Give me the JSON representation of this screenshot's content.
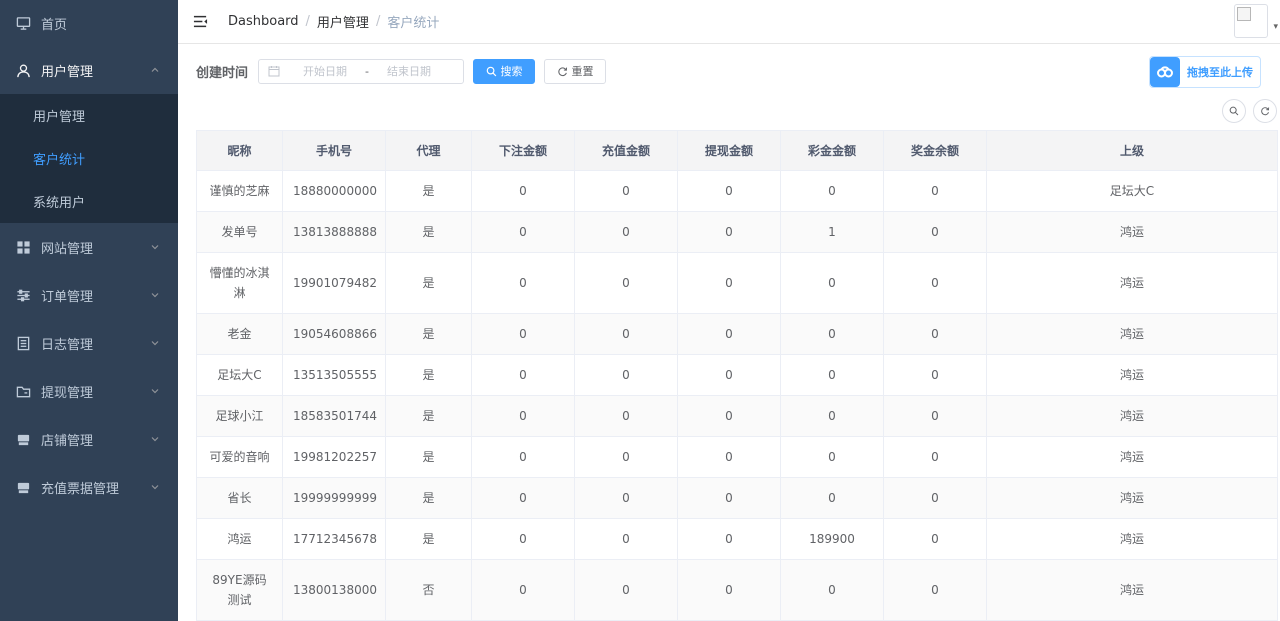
{
  "sidebar": {
    "home": "首页",
    "user_mgmt": "用户管理",
    "sub": [
      "用户管理",
      "客户统计",
      "系统用户"
    ],
    "groups": [
      "网站管理",
      "订单管理",
      "日志管理",
      "提现管理",
      "店铺管理",
      "充值票据管理"
    ]
  },
  "header": {
    "breadcrumb": [
      "Dashboard",
      "用户管理",
      "客户统计"
    ],
    "separator": "/"
  },
  "filter": {
    "label": "创建时间",
    "start_placeholder": "开始日期",
    "range_separator": "-",
    "end_placeholder": "结束日期",
    "search_label": "搜索",
    "reset_label": "重置"
  },
  "upload": {
    "label": "拖拽至此上传"
  },
  "table": {
    "columns": [
      "昵称",
      "手机号",
      "代理",
      "下注金额",
      "充值金额",
      "提现金额",
      "彩金金额",
      "奖金余额",
      "上级"
    ],
    "rows": [
      [
        "谨慎的芝麻",
        "18880000000",
        "是",
        "0",
        "0",
        "0",
        "0",
        "0",
        "足坛大C"
      ],
      [
        "发单号",
        "13813888888",
        "是",
        "0",
        "0",
        "0",
        "1",
        "0",
        "鸿运"
      ],
      [
        "懵懂的冰淇淋",
        "19901079482",
        "是",
        "0",
        "0",
        "0",
        "0",
        "0",
        "鸿运"
      ],
      [
        "老金",
        "19054608866",
        "是",
        "0",
        "0",
        "0",
        "0",
        "0",
        "鸿运"
      ],
      [
        "足坛大C",
        "13513505555",
        "是",
        "0",
        "0",
        "0",
        "0",
        "0",
        "鸿运"
      ],
      [
        "足球小江",
        "18583501744",
        "是",
        "0",
        "0",
        "0",
        "0",
        "0",
        "鸿运"
      ],
      [
        "可爱的音响",
        "19981202257",
        "是",
        "0",
        "0",
        "0",
        "0",
        "0",
        "鸿运"
      ],
      [
        "省长",
        "19999999999",
        "是",
        "0",
        "0",
        "0",
        "0",
        "0",
        "鸿运"
      ],
      [
        "鸿运",
        "17712345678",
        "是",
        "0",
        "0",
        "0",
        "189900",
        "0",
        "鸿运"
      ],
      [
        "89YE源码测试",
        "13800138000",
        "否",
        "0",
        "0",
        "0",
        "0",
        "0",
        "鸿运"
      ]
    ]
  },
  "colors": {
    "sidebar_bg": "#304156",
    "submenu_bg": "#1f2d3d",
    "accent": "#409eff"
  }
}
